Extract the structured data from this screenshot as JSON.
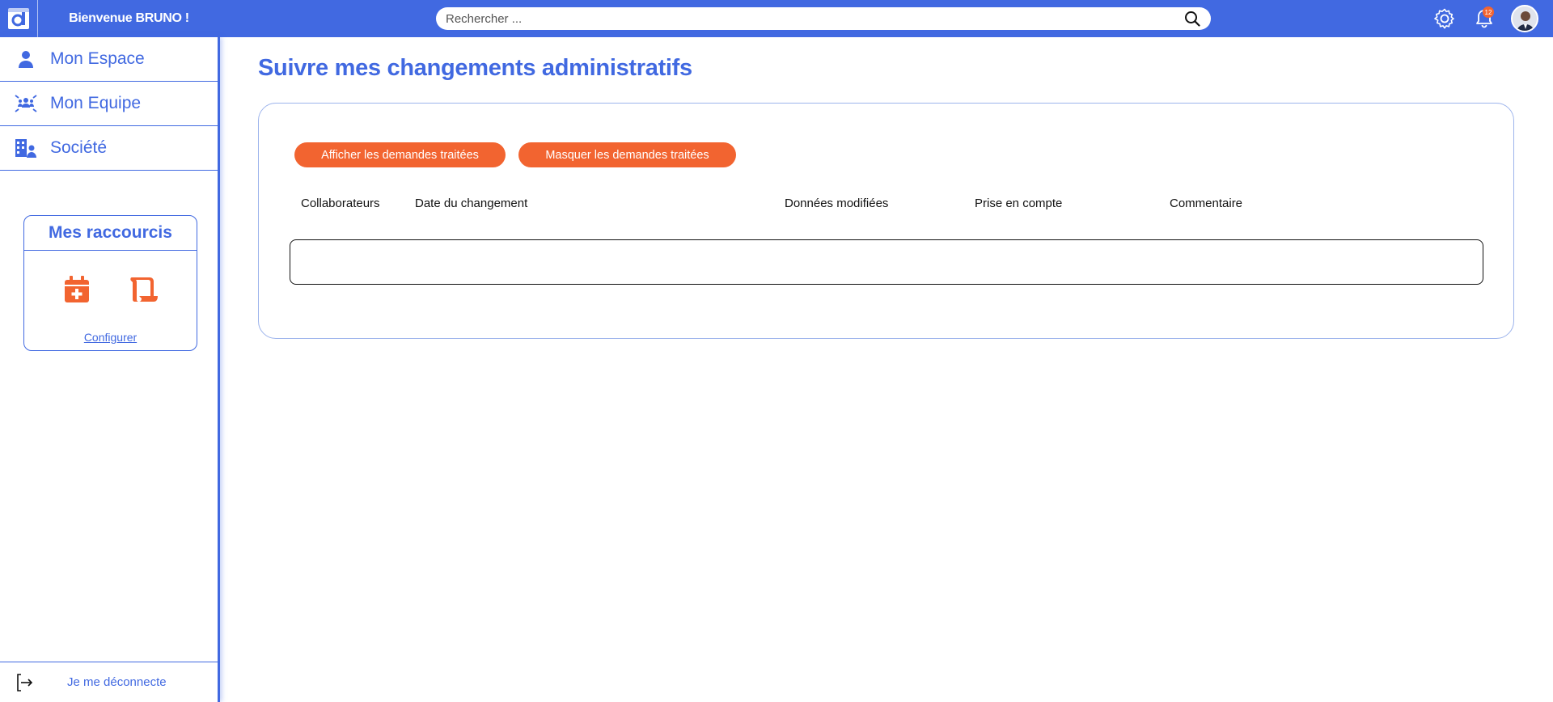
{
  "header": {
    "welcome": "Bienvenue BRUNO !",
    "search_placeholder": "Rechercher ...",
    "notification_count": "12"
  },
  "sidebar": {
    "items": [
      {
        "label": "Mon Espace",
        "icon": "user-icon"
      },
      {
        "label": "Mon Equipe",
        "icon": "team-icon"
      },
      {
        "label": "Société",
        "icon": "company-icon"
      }
    ],
    "shortcuts": {
      "title": "Mes raccourcis",
      "icons": [
        "calendar-add-icon",
        "scroll-icon"
      ],
      "configure_label": "Configurer"
    },
    "logout_label": "Je me déconnecte"
  },
  "main": {
    "title": "Suivre mes changements administratifs",
    "buttons": {
      "show_label": "Afficher les demandes traitées",
      "hide_label": "Masquer les demandes traitées"
    },
    "table": {
      "columns": [
        "Collaborateurs",
        "Date du changement",
        "Données modifiées",
        "Prise en compte",
        "Commentaire"
      ],
      "rows": []
    }
  },
  "colors": {
    "primary": "#4169e1",
    "accent": "#f26430"
  }
}
